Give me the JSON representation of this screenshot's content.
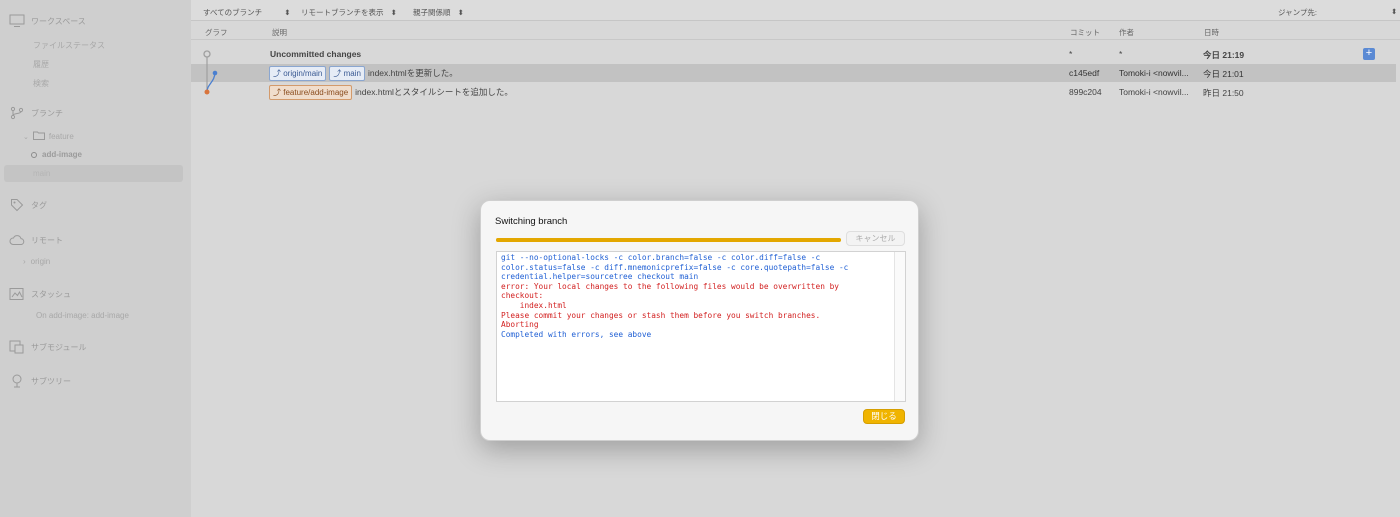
{
  "sidebar": {
    "workspace": {
      "label": "ワークスペース",
      "icon": "monitor-icon"
    },
    "workspace_items": [
      "ファイルステータス",
      "履歴",
      "検索"
    ],
    "branches": {
      "label": "ブランチ",
      "icon": "branch-icon"
    },
    "branch_folder": "feature",
    "branch_items": [
      "add-image",
      "main"
    ],
    "tags": {
      "label": "タグ",
      "icon": "tag-icon"
    },
    "remotes": {
      "label": "リモート",
      "icon": "cloud-icon"
    },
    "remote_items": [
      "origin"
    ],
    "stashes": {
      "label": "スタッシュ",
      "icon": "stash-icon"
    },
    "stash_items": [
      "On add-image: add-image"
    ],
    "submodules": {
      "label": "サブモジュール",
      "icon": "submodule-icon"
    },
    "subtrees": {
      "label": "サブツリー",
      "icon": "subtree-icon"
    }
  },
  "toolbar": {
    "branches_filter": "すべてのブランチ",
    "remote_filter": "リモートブランチを表示",
    "order_filter": "親子関係順",
    "jump": "ジャンプ先:"
  },
  "columns": {
    "graph": "グラフ",
    "description": "説明",
    "commit": "コミット",
    "author": "作者",
    "date": "日時"
  },
  "commits": [
    {
      "description": "Uncommitted changes",
      "commit": "*",
      "author": "*",
      "date": "今日 21:19"
    },
    {
      "tags": [
        "origin/main",
        "main"
      ],
      "description": "index.htmlを更新した。",
      "commit": "c145edf",
      "author": "Tomoki-i <nowvil...",
      "date": "今日 21:01"
    },
    {
      "tags": [
        "feature/add-image"
      ],
      "description": "index.htmlとスタイルシートを追加した。",
      "commit": "899c204",
      "author": "Tomoki-i <nowvil...",
      "date": "昨日 21:50"
    }
  ],
  "dialog": {
    "title": "Switching branch",
    "progress": 1.0,
    "cancel_label": "キャンセル",
    "close_label": "閉じる",
    "log_lines": [
      {
        "text": "git --no-optional-locks -c color.branch=false -c color.diff=false -c",
        "kind": "blue"
      },
      {
        "text": "color.status=false -c diff.mnemonicprefix=false -c core.quotepath=false -c",
        "kind": "blue"
      },
      {
        "text": "credential.helper=sourcetree checkout main",
        "kind": "blue"
      },
      {
        "text": "error: Your local changes to the following files would be overwritten by",
        "kind": "red"
      },
      {
        "text": "checkout:",
        "kind": "red"
      },
      {
        "text": "\tindex.html",
        "kind": "red"
      },
      {
        "text": "Please commit your changes or stash them before you switch branches.",
        "kind": "red"
      },
      {
        "text": "Aborting",
        "kind": "red"
      },
      {
        "text": "Completed with errors, see above",
        "kind": "blue"
      }
    ]
  },
  "colors": {
    "progress": "#e3a700",
    "close_button": "#f0b400",
    "error_text": "#d21f1f",
    "command_text": "#1f5fd4",
    "branch_graph_blue": "#4a7fd0",
    "branch_graph_orange": "#d8743c"
  }
}
